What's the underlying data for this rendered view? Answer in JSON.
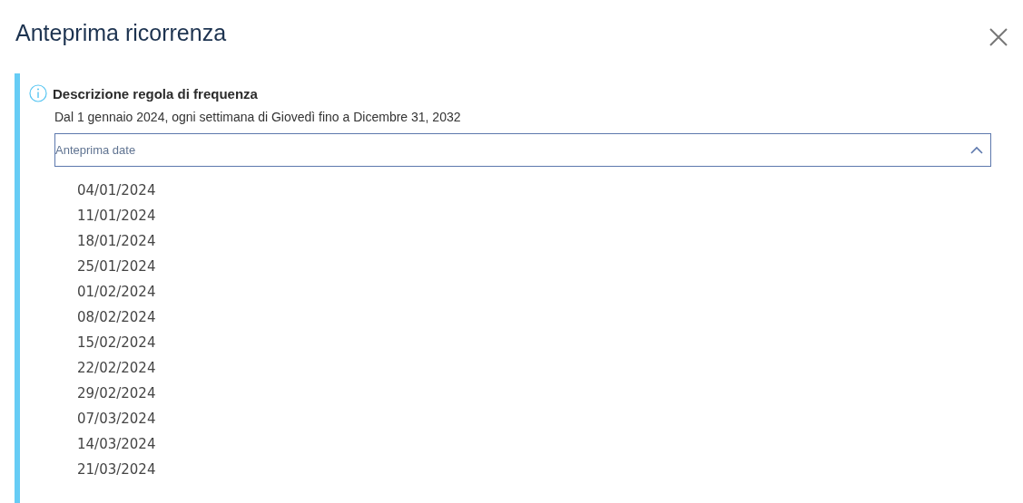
{
  "dialog": {
    "title": "Anteprima ricorrenza"
  },
  "rule": {
    "heading": "Descrizione regola di frequenza",
    "description": "Dal 1 gennaio 2024, ogni settimana di Giovedì fino a Dicembre 31, 2032"
  },
  "preview": {
    "label": "Anteprima date",
    "expanded": true,
    "dates": [
      "04/01/2024",
      "11/01/2024",
      "18/01/2024",
      "25/01/2024",
      "01/02/2024",
      "08/02/2024",
      "15/02/2024",
      "22/02/2024",
      "29/02/2024",
      "07/03/2024",
      "14/03/2024",
      "21/03/2024"
    ]
  }
}
